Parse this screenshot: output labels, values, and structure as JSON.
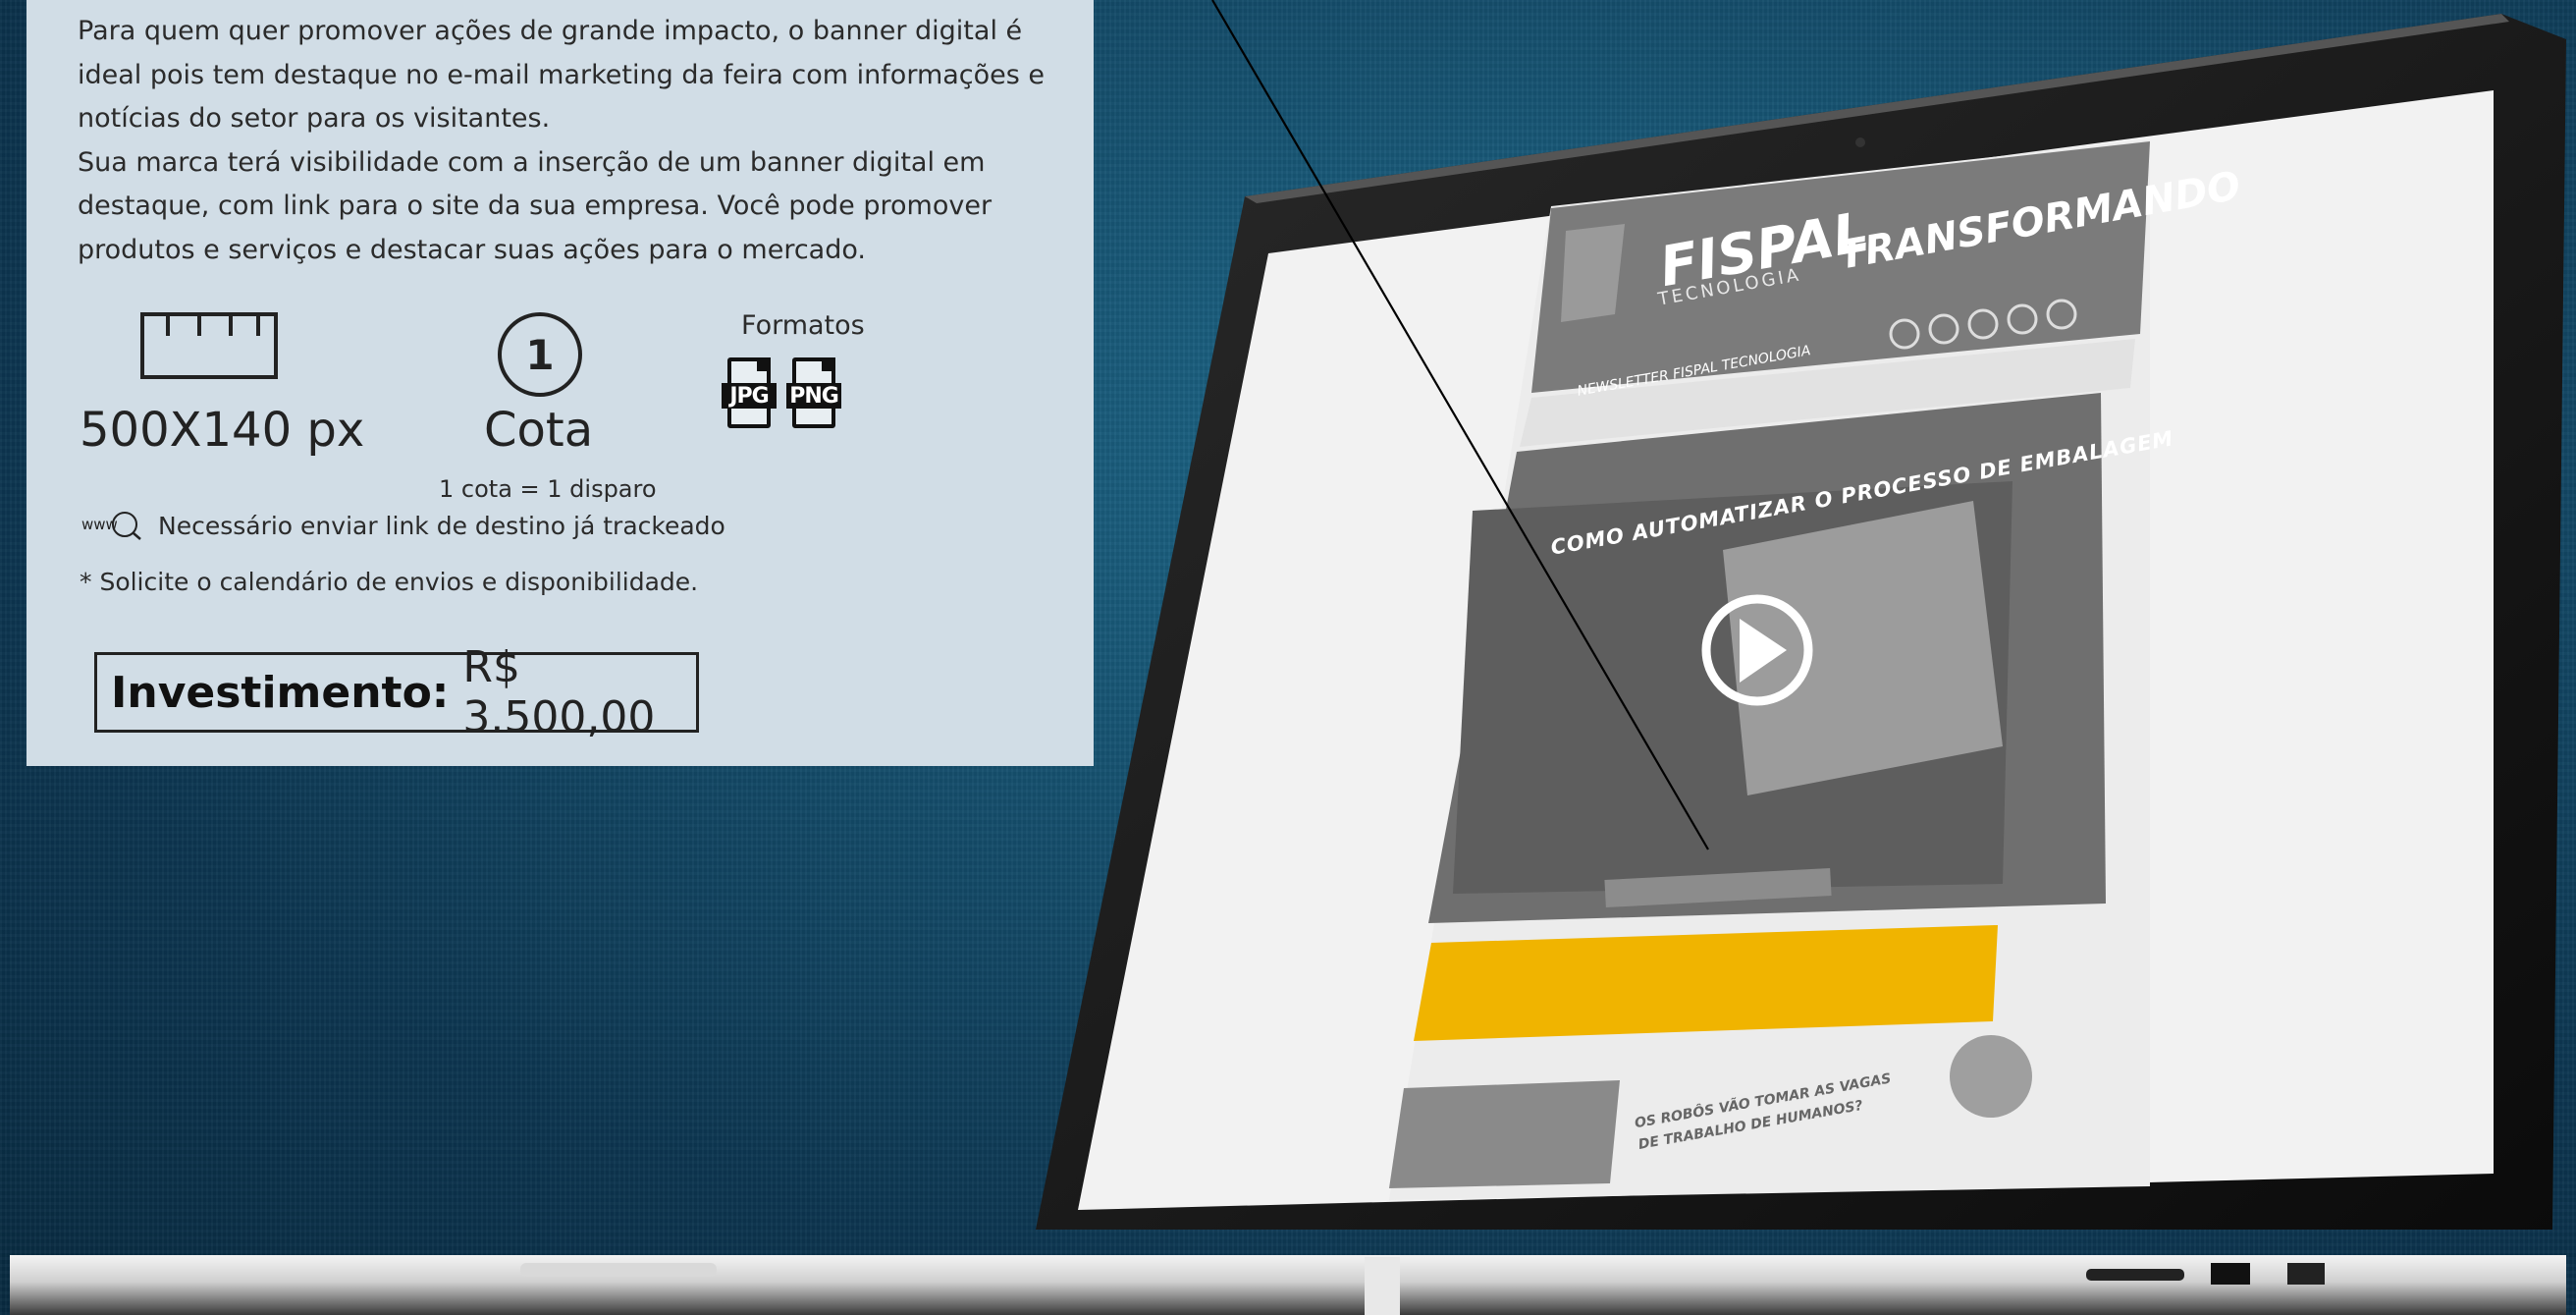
{
  "description": {
    "paragraphs": [
      "Para quem quer promover ações de grande impacto, o banner digital é",
      "ideal pois tem destaque no e-mail marketing da feira com informações e",
      "notícias do setor para os visitantes.",
      "Sua marca terá visibilidade com a inserção de um banner digital em",
      "destaque, com link para o site da sua empresa. Você pode promover",
      "produtos e serviços e destacar suas ações para o mercado."
    ]
  },
  "specs": {
    "size": {
      "icon": "ruler-icon",
      "value": "500X140 px"
    },
    "quota": {
      "icon_number": "1",
      "label": "Cota",
      "note": "1 cota = 1 disparo"
    },
    "formats": {
      "label": "Formatos",
      "items": [
        "JPG",
        "PNG"
      ]
    }
  },
  "link_note": {
    "icon_text": "www",
    "text": "Necessário enviar link de destino já trackeado"
  },
  "footnote": "* Solicite o calendário de envios e disponibilidade.",
  "investment": {
    "label": "Investimento:",
    "value": "R$ 3.500,00"
  },
  "newsletter_preview": {
    "brand": "FISPAL",
    "brand_sub": "TECNOLOGIA",
    "slogan": "TRANSFORMANDO",
    "newsletter_label": "NEWSLETTER FISPAL TECNOLOGIA",
    "headline": "COMO AUTOMATIZAR O PROCESSO DE EMBALAGEM",
    "article_title": "OS ROBÔS VÃO TOMAR AS VAGAS DE TRABALHO DE HUMANOS?",
    "banner_color": "#f0b400"
  },
  "colors": {
    "panel_bg": "#d1dde6",
    "background": "#15506e",
    "text": "#2b2b2b"
  }
}
